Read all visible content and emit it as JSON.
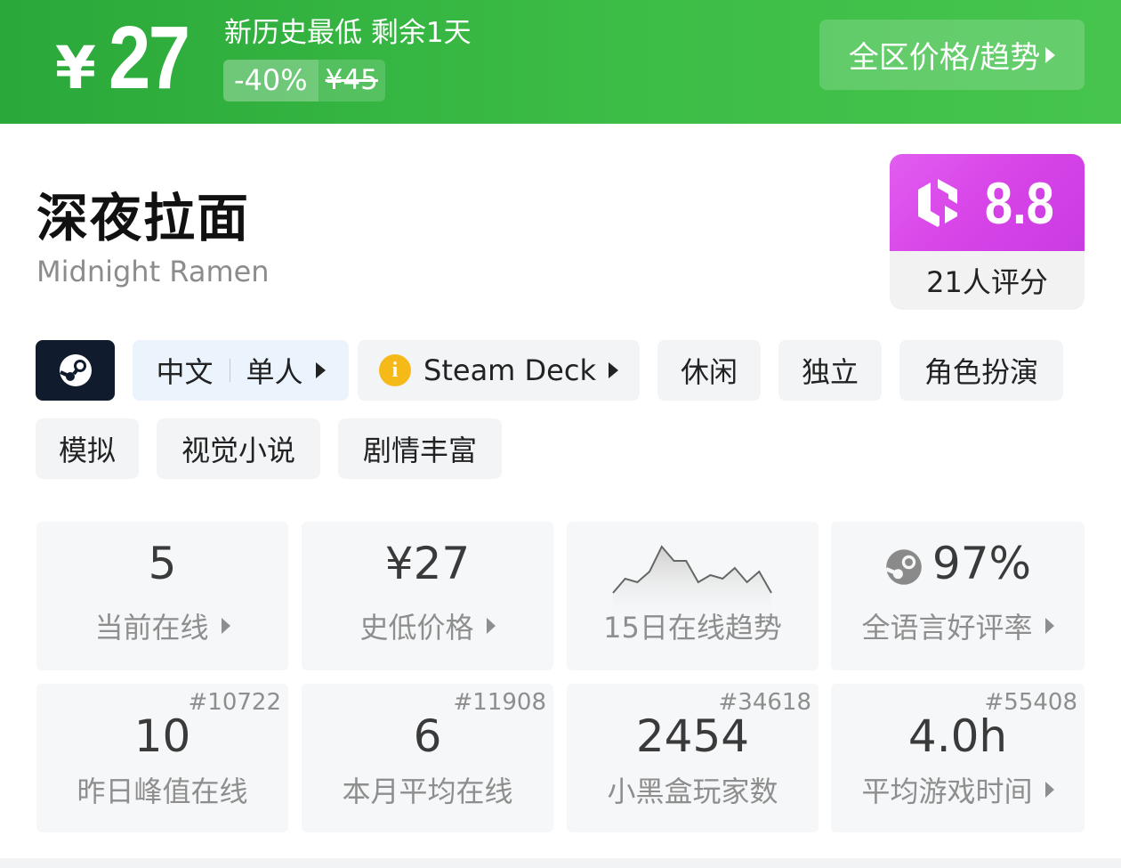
{
  "banner": {
    "price_symbol": "¥",
    "price": "27",
    "deal_text": "新历史最低 剩余1天",
    "discount": "-40%",
    "original_price": "¥45",
    "region_button": "全区价格/趋势"
  },
  "game": {
    "title_cn": "深夜拉面",
    "title_en": "Midnight Ramen"
  },
  "score": {
    "value": "8.8",
    "raters": "21人评分"
  },
  "tags": {
    "language": "中文",
    "mode": "单人",
    "deck": "Steam Deck",
    "deck_info_glyph": "i",
    "genres": [
      "休闲",
      "独立",
      "角色扮演",
      "模拟",
      "视觉小说",
      "剧情丰富"
    ]
  },
  "stats": {
    "current_online": {
      "value": "5",
      "label": "当前在线"
    },
    "lowest_price": {
      "value": "¥27",
      "label": "史低价格"
    },
    "trend": {
      "label": "15日在线趋势",
      "points": [
        2,
        6,
        5,
        8,
        15,
        11,
        11,
        5,
        7,
        6,
        9,
        5,
        8,
        2
      ]
    },
    "rating": {
      "value": "97%",
      "label": "全语言好评率"
    },
    "peak_yesterday": {
      "value": "10",
      "label": "昨日峰值在线",
      "rank": "#10722"
    },
    "month_avg": {
      "value": "6",
      "label": "本月平均在线",
      "rank": "#11908"
    },
    "players": {
      "value": "2454",
      "label": "小黑盒玩家数",
      "rank": "#34618"
    },
    "avg_playtime": {
      "value": "4.0h",
      "label": "平均游戏时间",
      "rank": "#55408"
    }
  },
  "colors": {
    "banner_green": "#3cbd46",
    "score_magenta": "#d744e8",
    "steam_dark": "#101b2d",
    "deck_yellow": "#f5b918"
  },
  "icons": [
    "steam-logo-icon",
    "heybox-logo-icon",
    "info-icon",
    "chevron-right-icon",
    "steam-review-icon"
  ]
}
